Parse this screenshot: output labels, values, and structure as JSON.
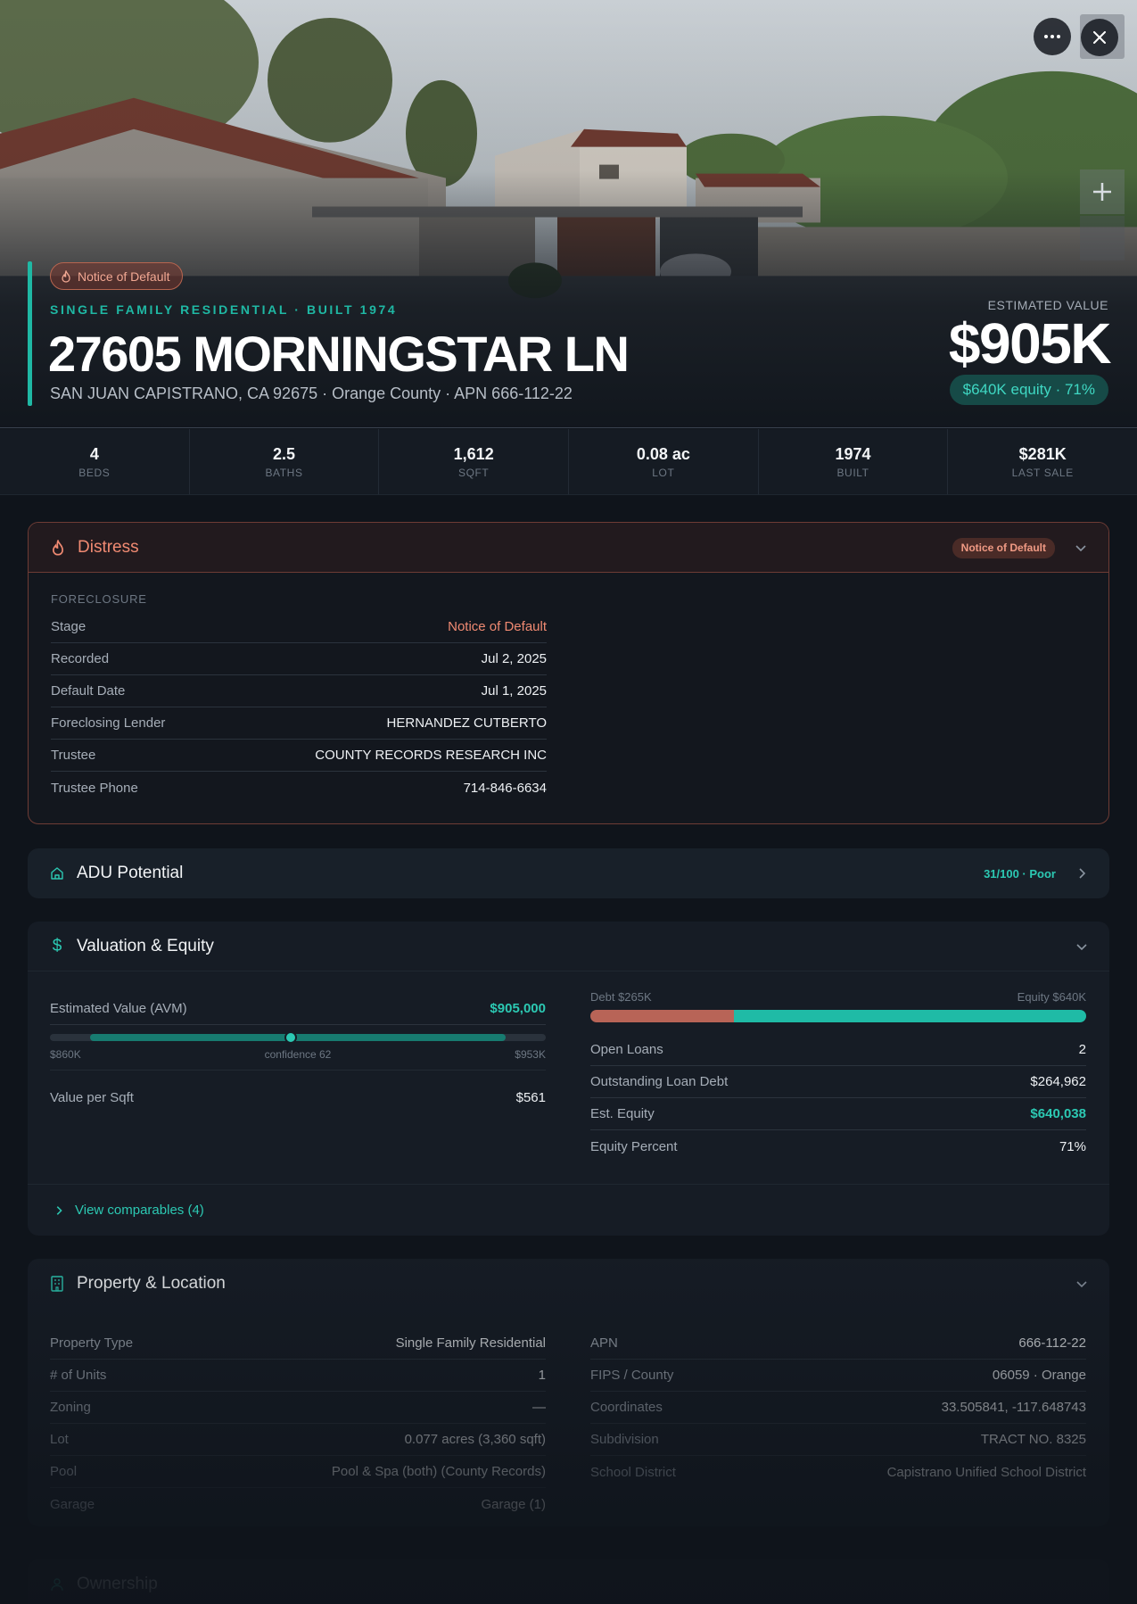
{
  "hero": {
    "badge": "Notice of Default",
    "subtitle": "SINGLE FAMILY RESIDENTIAL · BUILT 1974",
    "title": "27605 MORNINGSTAR LN",
    "address": "SAN JUAN CAPISTRANO, CA 92675 · Orange County · APN 666-112-22",
    "estimated_label": "ESTIMATED VALUE",
    "estimated_value": "$905K",
    "equity_pill": "$640K equity · 71%"
  },
  "stats": [
    {
      "value": "4",
      "label": "BEDS"
    },
    {
      "value": "2.5",
      "label": "BATHS"
    },
    {
      "value": "1,612",
      "label": "SQFT"
    },
    {
      "value": "0.08 ac",
      "label": "LOT"
    },
    {
      "value": "1974",
      "label": "BUILT"
    },
    {
      "value": "$281K",
      "label": "LAST SALE"
    }
  ],
  "distress": {
    "title": "Distress",
    "badge": "Notice of Default",
    "section": "FORECLOSURE",
    "rows": [
      {
        "k": "Stage",
        "v": "Notice of Default"
      },
      {
        "k": "Recorded",
        "v": "Jul 2, 2025"
      },
      {
        "k": "Default Date",
        "v": "Jul 1, 2025"
      },
      {
        "k": "Foreclosing Lender",
        "v": "HERNANDEZ CUTBERTO"
      },
      {
        "k": "Trustee",
        "v": "COUNTY RECORDS RESEARCH INC"
      },
      {
        "k": "Trustee Phone",
        "v": "714-846-6634"
      }
    ]
  },
  "adu": {
    "title": "ADU Potential",
    "score": "31/100 · Poor"
  },
  "valuation": {
    "title": "Valuation & Equity",
    "avm_label": "Estimated Value (AVM)",
    "avm_value": "$905,000",
    "range_low": "$860K",
    "range_high": "$953K",
    "confidence": "confidence 62",
    "avm_range_low": 860000,
    "avm_range_high": 953000,
    "avm_estimate": 905000,
    "value_per_sqft_label": "Value per Sqft",
    "value_per_sqft": "$561",
    "debt_label": "Debt $265K",
    "equity_label": "Equity $640K",
    "debt_fraction": 0.29,
    "right_rows": [
      {
        "k": "Open Loans",
        "v": "2"
      },
      {
        "k": "Outstanding Loan Debt",
        "v": "$264,962"
      },
      {
        "k": "Est. Equity",
        "v": "$640,038"
      },
      {
        "k": "Equity Percent",
        "v": "71%"
      }
    ],
    "comparables_link": "View comparables (4)"
  },
  "property": {
    "title": "Property & Location",
    "left_rows": [
      {
        "k": "Property Type",
        "v": "Single Family Residential"
      },
      {
        "k": "# of Units",
        "v": "1"
      },
      {
        "k": "Zoning",
        "v": "—"
      },
      {
        "k": "Lot",
        "v": "0.077 acres (3,360 sqft)"
      },
      {
        "k": "Pool",
        "v": "Pool & Spa (both) (County Records)"
      },
      {
        "k": "Garage",
        "v": "Garage (1)"
      }
    ],
    "right_rows": [
      {
        "k": "APN",
        "v": "666-112-22"
      },
      {
        "k": "FIPS / County",
        "v": "06059 · Orange"
      },
      {
        "k": "Coordinates",
        "v": "33.505841, -117.648743"
      },
      {
        "k": "Subdivision",
        "v": "TRACT NO. 8325"
      },
      {
        "k": "School District",
        "v": "Capistrano Unified School District"
      }
    ]
  },
  "ownership": {
    "title": "Ownership"
  },
  "colors": {
    "accent": "#1fb8a4",
    "distress": "#f08a72",
    "debt": "#b86457",
    "equity": "#1fbba6"
  }
}
